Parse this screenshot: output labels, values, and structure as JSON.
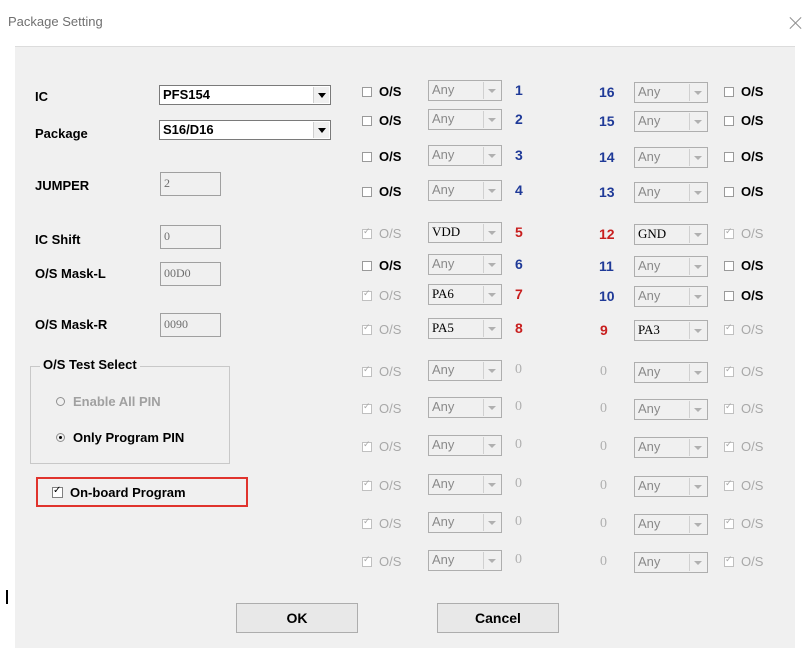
{
  "window": {
    "title": "Package Setting"
  },
  "left": {
    "ic_label": "IC",
    "ic_value": "PFS154",
    "package_label": "Package",
    "package_value": "S16/D16",
    "jumper_label": "JUMPER",
    "jumper_value": "2",
    "icshift_label": "IC Shift",
    "icshift_value": "0",
    "maskl_label": "O/S Mask-L",
    "maskl_value": "00D0",
    "maskr_label": "O/S Mask-R",
    "maskr_value": "0090",
    "group_title": "O/S Test Select",
    "radio_all": "Enable All PIN",
    "radio_program": "Only Program PIN",
    "onboard_label": "On-board Program"
  },
  "os_label": "O/S",
  "pins_left": [
    {
      "num": "1",
      "combo": "Any",
      "state": "en",
      "color": "blue"
    },
    {
      "num": "2",
      "combo": "Any",
      "state": "en",
      "color": "blue"
    },
    {
      "num": "3",
      "combo": "Any",
      "state": "en",
      "color": "blue"
    },
    {
      "num": "4",
      "combo": "Any",
      "state": "en",
      "color": "blue"
    },
    {
      "num": "5",
      "combo": "VDD",
      "state": "dis",
      "color": "red"
    },
    {
      "num": "6",
      "combo": "Any",
      "state": "en",
      "color": "blue"
    },
    {
      "num": "7",
      "combo": "PA6",
      "state": "dis",
      "color": "red"
    },
    {
      "num": "8",
      "combo": "PA5",
      "state": "dis",
      "color": "red"
    },
    {
      "num": "0",
      "combo": "Any",
      "state": "dis",
      "color": "grey"
    },
    {
      "num": "0",
      "combo": "Any",
      "state": "dis",
      "color": "grey"
    },
    {
      "num": "0",
      "combo": "Any",
      "state": "dis",
      "color": "grey"
    },
    {
      "num": "0",
      "combo": "Any",
      "state": "dis",
      "color": "grey"
    },
    {
      "num": "0",
      "combo": "Any",
      "state": "dis",
      "color": "grey"
    },
    {
      "num": "0",
      "combo": "Any",
      "state": "dis",
      "color": "grey"
    }
  ],
  "pins_right": [
    {
      "num": "16",
      "combo": "Any",
      "state": "en",
      "color": "blue"
    },
    {
      "num": "15",
      "combo": "Any",
      "state": "en",
      "color": "blue"
    },
    {
      "num": "14",
      "combo": "Any",
      "state": "en",
      "color": "blue"
    },
    {
      "num": "13",
      "combo": "Any",
      "state": "en",
      "color": "blue"
    },
    {
      "num": "12",
      "combo": "GND",
      "state": "dis",
      "color": "red"
    },
    {
      "num": "11",
      "combo": "Any",
      "state": "en",
      "color": "blue"
    },
    {
      "num": "10",
      "combo": "Any",
      "state": "en",
      "color": "blue"
    },
    {
      "num": "9",
      "combo": "PA3",
      "state": "dis",
      "color": "red"
    },
    {
      "num": "0",
      "combo": "Any",
      "state": "dis",
      "color": "grey"
    },
    {
      "num": "0",
      "combo": "Any",
      "state": "dis",
      "color": "grey"
    },
    {
      "num": "0",
      "combo": "Any",
      "state": "dis",
      "color": "grey"
    },
    {
      "num": "0",
      "combo": "Any",
      "state": "dis",
      "color": "grey"
    },
    {
      "num": "0",
      "combo": "Any",
      "state": "dis",
      "color": "grey"
    },
    {
      "num": "0",
      "combo": "Any",
      "state": "dis",
      "color": "grey"
    }
  ],
  "buttons": {
    "ok": "OK",
    "cancel": "Cancel"
  },
  "colors": {
    "accent_red": "#e0332d",
    "pin_blue": "#1f3a98",
    "pin_red": "#c81e1e"
  }
}
